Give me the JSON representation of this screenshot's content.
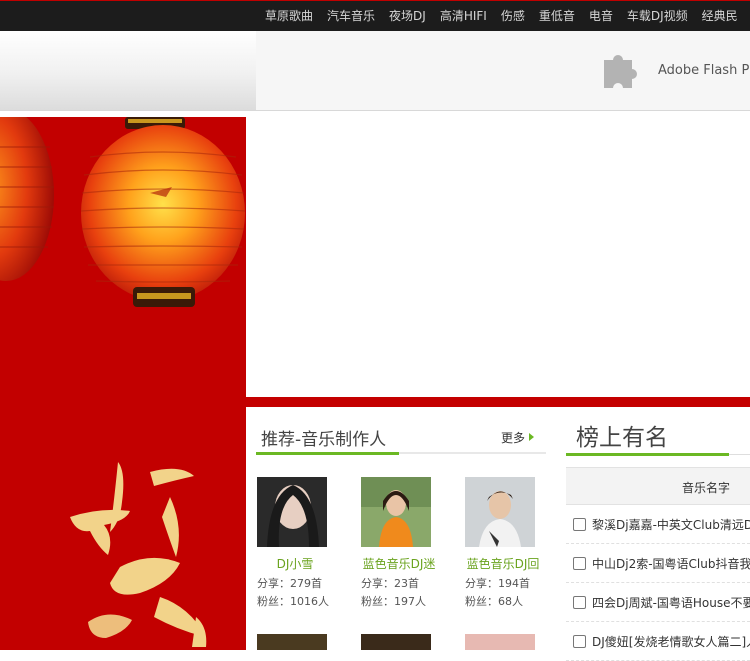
{
  "nav": {
    "items": [
      "草原歌曲",
      "汽车音乐",
      "夜场DJ",
      "高清HIFI",
      "伤感",
      "重低音",
      "电音",
      "车载DJ视频",
      "经典民"
    ]
  },
  "plugin": {
    "label": "Adobe Flash P"
  },
  "banner": {
    "calligraphy": "吉祥如意"
  },
  "recommend": {
    "title": "推荐-音乐制作人",
    "more": "更多",
    "artists": [
      {
        "name": "DJ小雪",
        "share": "分享：279首",
        "fans": "粉丝：1016人"
      },
      {
        "name": "蓝色音乐DJ迷",
        "share": "分享：23首",
        "fans": "粉丝：197人"
      },
      {
        "name": "蓝色音乐DJ回",
        "share": "分享：194首",
        "fans": "粉丝：68人"
      }
    ]
  },
  "chart": {
    "title": "榜上有名",
    "column_header": "音乐名字",
    "songs": [
      "黎溪Dj嘉嘉-中英文Club清远D",
      "中山Dj2索-国粤语Club抖音我",
      "四会Dj周斌-国粤语House不要",
      "DJ傻妞[发烧老情歌女人篇二]人"
    ]
  },
  "colors": {
    "accent_green": "#6bb823",
    "banner_red": "#c20000",
    "topbar": "#1c1c1c"
  },
  "icons": {
    "plugin": "puzzle-piece-icon",
    "more": "arrow-right-icon"
  }
}
